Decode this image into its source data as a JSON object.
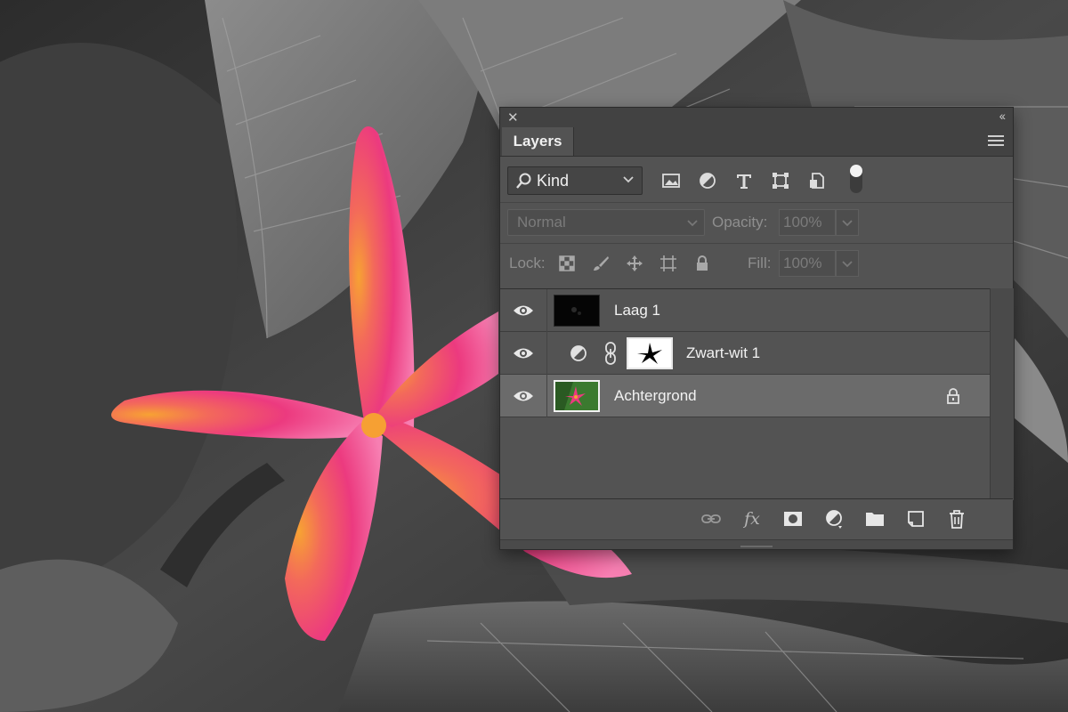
{
  "panel": {
    "tab_label": "Layers",
    "close_glyph": "✕",
    "collapse_glyph": "‹‹",
    "filter": {
      "kind_label": "Kind",
      "icons": [
        "image-filter-icon",
        "adjustment-filter-icon",
        "type-filter-icon",
        "shape-filter-icon",
        "smart-object-filter-icon"
      ]
    },
    "blend": {
      "mode": "Normal",
      "opacity_label": "Opacity:",
      "opacity_value": "100%"
    },
    "lock": {
      "label": "Lock:",
      "icons": [
        "lock-transparent-icon",
        "lock-image-icon",
        "lock-position-icon",
        "lock-artboard-icon",
        "lock-all-icon"
      ],
      "fill_label": "Fill:",
      "fill_value": "100%"
    },
    "layers": [
      {
        "name": "Laag 1",
        "visible": true,
        "selected": false
      },
      {
        "name": "Zwart-wit 1",
        "visible": true,
        "selected": false,
        "adjustment": true
      },
      {
        "name": "Achtergrond",
        "visible": true,
        "selected": true,
        "locked": true
      }
    ],
    "footer_icons": [
      "link-layers-icon",
      "fx-icon",
      "add-mask-icon",
      "new-adjustment-icon",
      "new-group-icon",
      "new-layer-icon",
      "trash-icon"
    ],
    "fx_label": "fx"
  },
  "colors": {
    "panel_bg": "#535353",
    "selected_row": "#6b6b6b",
    "flower_pink": "#ec3a7f",
    "flower_orange": "#f7a233"
  }
}
